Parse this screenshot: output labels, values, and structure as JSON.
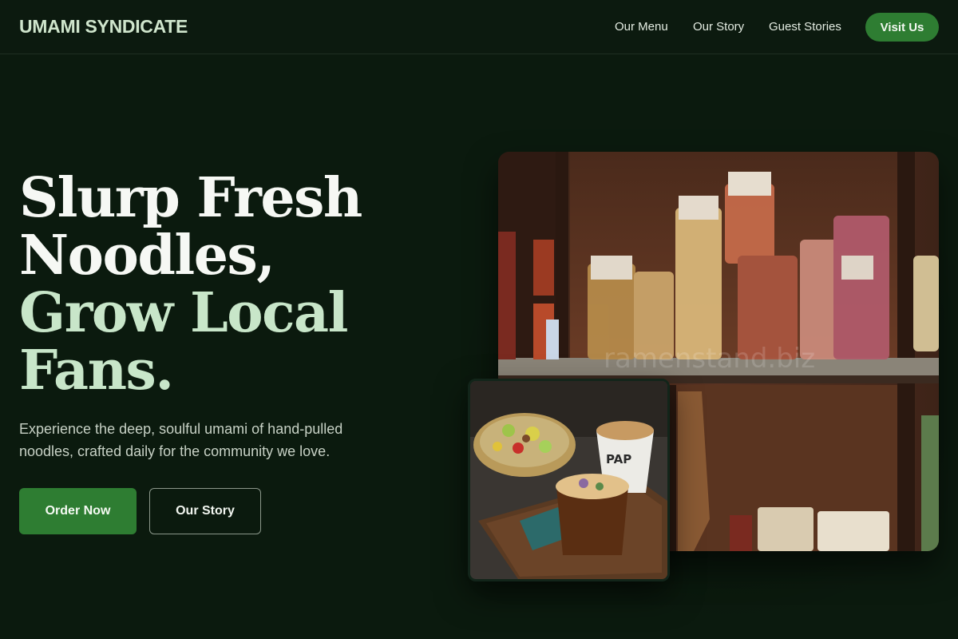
{
  "header": {
    "brand": "UMAMI SYNDICATE",
    "nav": [
      "Our Menu",
      "Our Story",
      "Guest Stories"
    ],
    "cta": "Visit Us"
  },
  "hero": {
    "title_line1": "Slurp Fresh",
    "title_line2": "Noodles,",
    "title_line3": "Grow Local",
    "title_line4": "Fans.",
    "description": "Experience the deep, soulful umami of hand-pulled noodles, crafted daily for the community we love.",
    "primary_button": "Order Now",
    "secondary_button": "Our Story"
  },
  "images": {
    "main_alt": "Shelves of packaged fresh pasta and noodles",
    "main_watermark": "ramenstand.biz",
    "secondary_alt": "Noodle bowl with coffee drinks on a wooden tray",
    "cup_label": "PAP"
  },
  "colors": {
    "background": "#0b1a0e",
    "accent": "#2e7d32",
    "title_green": "#c8e6c9"
  }
}
